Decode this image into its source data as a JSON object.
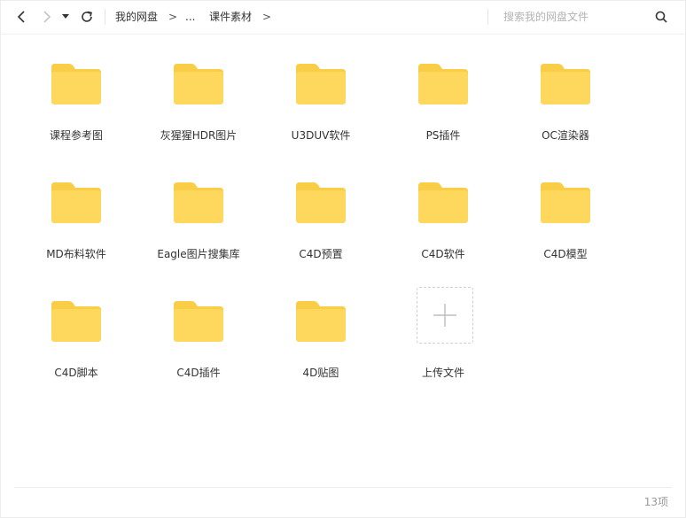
{
  "breadcrumb": {
    "root": "我的网盘",
    "ellipsis": "...",
    "current": "课件素材",
    "arrow": ">"
  },
  "search": {
    "placeholder": "搜索我的网盘文件"
  },
  "items": [
    {
      "label": "课程参考图",
      "type": "folder"
    },
    {
      "label": "灰猩猩HDR图片",
      "type": "folder"
    },
    {
      "label": "U3DUV软件",
      "type": "folder"
    },
    {
      "label": "PS插件",
      "type": "folder"
    },
    {
      "label": "OC渲染器",
      "type": "folder"
    },
    {
      "label": "MD布料软件",
      "type": "folder"
    },
    {
      "label": "Eagle图片搜集库",
      "type": "folder"
    },
    {
      "label": "C4D预置",
      "type": "folder"
    },
    {
      "label": "C4D软件",
      "type": "folder"
    },
    {
      "label": "C4D模型",
      "type": "folder"
    },
    {
      "label": "C4D脚本",
      "type": "folder"
    },
    {
      "label": "C4D插件",
      "type": "folder"
    },
    {
      "label": "4D贴图",
      "type": "folder"
    },
    {
      "label": "上传文件",
      "type": "upload"
    }
  ],
  "footer": {
    "count": "13项"
  },
  "colors": {
    "folder": "#fdd85c",
    "folder_tab": "#f9cd45",
    "icon": "#333333",
    "icon_disabled": "#c4c4c4"
  },
  "icons": {
    "back": "chevron-left-icon",
    "forward": "chevron-right-icon",
    "dropdown": "caret-down-icon",
    "refresh": "refresh-icon",
    "search": "search-icon",
    "upload": "plus-icon"
  }
}
